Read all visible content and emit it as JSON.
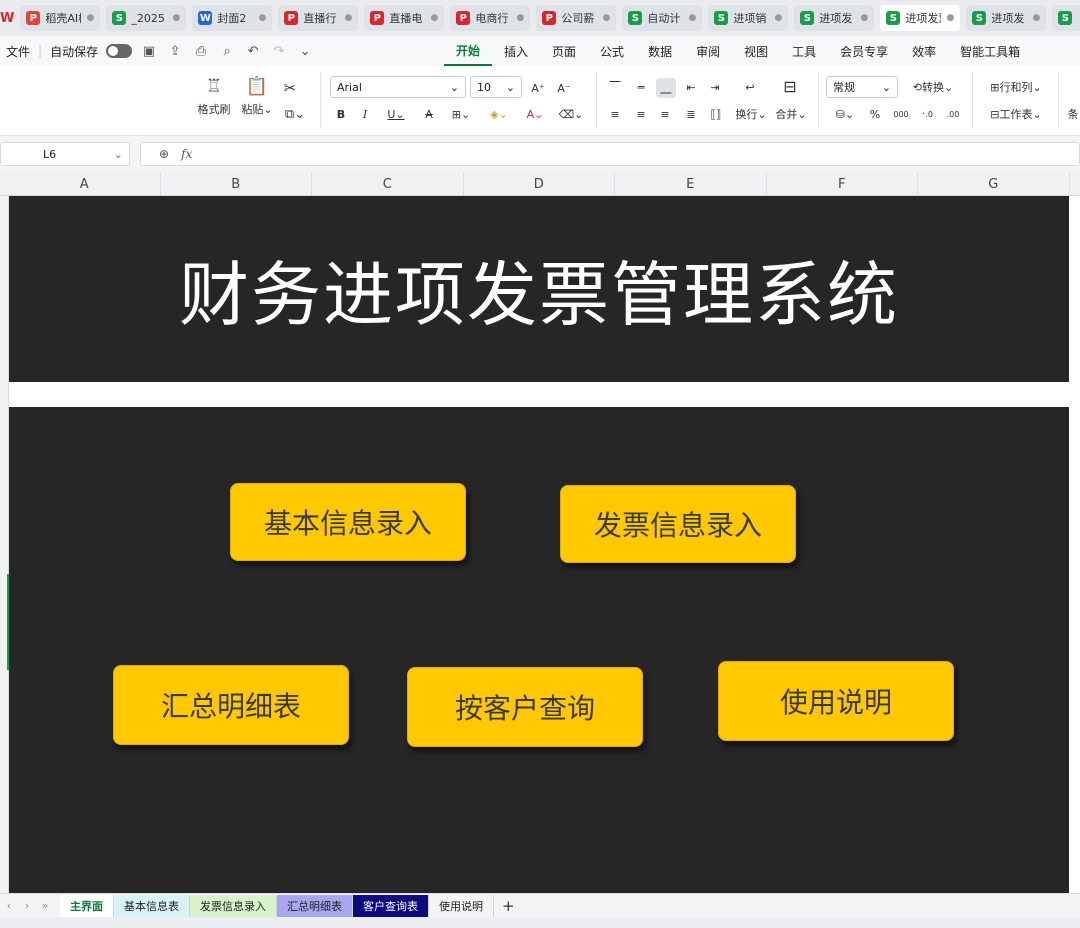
{
  "app_logo": "W",
  "doc_tabs": [
    {
      "icon": "D",
      "name": "稻壳AI模",
      "active": false
    },
    {
      "icon": "S",
      "name": "_2025",
      "active": false
    },
    {
      "icon": "W",
      "name": "封面2",
      "active": false
    },
    {
      "icon": "P",
      "name": "直播行",
      "active": false
    },
    {
      "icon": "P",
      "name": "直播电",
      "active": false
    },
    {
      "icon": "P",
      "name": "电商行",
      "active": false
    },
    {
      "icon": "P",
      "name": "公司薪",
      "active": false
    },
    {
      "icon": "S",
      "name": "自动计",
      "active": false
    },
    {
      "icon": "S",
      "name": "进项销",
      "active": false
    },
    {
      "icon": "S",
      "name": "进项发",
      "active": false
    },
    {
      "icon": "S",
      "name": "进项发票",
      "active": true
    },
    {
      "icon": "S",
      "name": "进项发",
      "active": false
    },
    {
      "icon": "S",
      "name": "",
      "active": false
    }
  ],
  "menubar": {
    "file": "文件",
    "autosave": "自动保存",
    "tabs": [
      "开始",
      "插入",
      "页面",
      "公式",
      "数据",
      "审阅",
      "视图",
      "工具",
      "会员专享",
      "效率",
      "智能工具箱"
    ],
    "active_tab": "开始"
  },
  "ribbon": {
    "format_painter": "格式刷",
    "paste": "粘贴",
    "font_name": "Arial",
    "font_size": "10",
    "wrap": "换行",
    "merge": "合并",
    "number_format": "常规",
    "convert": "转换",
    "rows_cols": "行和列",
    "worksheet": "工作表",
    "cut_off": "条"
  },
  "formula_bar": {
    "cell_ref": "L6",
    "fx": "fx",
    "value": ""
  },
  "columns": [
    "A",
    "B",
    "C",
    "D",
    "E",
    "F",
    "G"
  ],
  "sheet": {
    "title": "财务进项发票管理系统",
    "buttons": {
      "basic_info": "基本信息录入",
      "invoice_entry": "发票信息录入",
      "summary": "汇总明细表",
      "customer_query": "按客户查询",
      "help": "使用说明"
    },
    "button_color": "#ffc800",
    "panel_color": "#262626"
  },
  "sheet_tabs": [
    {
      "label": "主界面",
      "bg": "#ffffff",
      "fg": "#0b7a3e",
      "active": true
    },
    {
      "label": "基本信息表",
      "bg": "#d7f3f7",
      "fg": "#222222",
      "active": false
    },
    {
      "label": "发票信息录入",
      "bg": "#d8f2c9",
      "fg": "#222222",
      "active": false
    },
    {
      "label": "汇总明细表",
      "bg": "#a9a6f0",
      "fg": "#222222",
      "active": false
    },
    {
      "label": "客户查询表",
      "bg": "#0c0a7e",
      "fg": "#ffffff",
      "active": false
    },
    {
      "label": "使用说明",
      "bg": "#f3f4f6",
      "fg": "#222222",
      "active": false
    }
  ]
}
